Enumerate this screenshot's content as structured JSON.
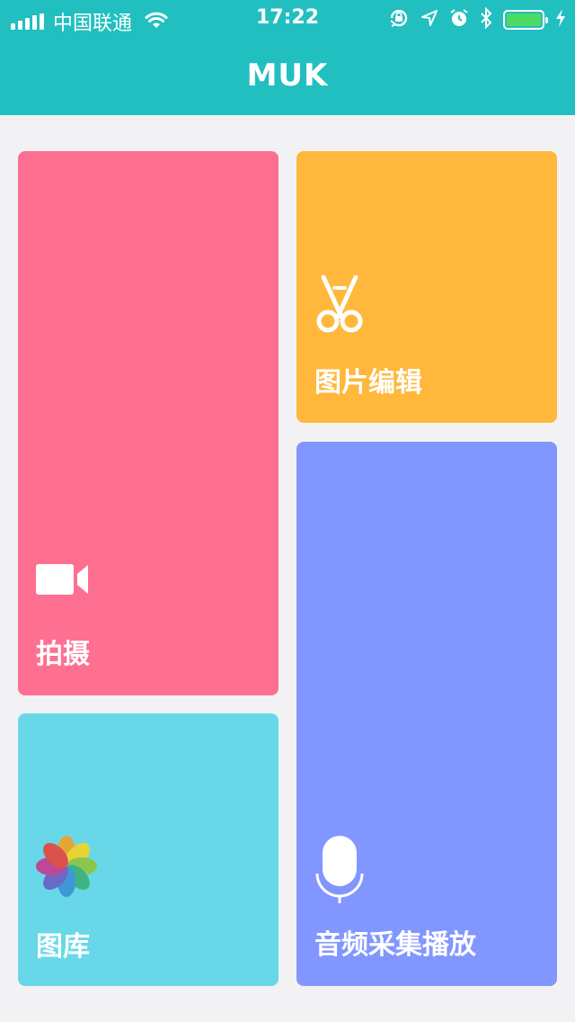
{
  "status_bar": {
    "carrier": "中国联通",
    "time": "17:22",
    "battery_level": 1.0
  },
  "nav": {
    "title": "MUK"
  },
  "tiles": [
    {
      "label": "拍摄",
      "icon": "video-camera-icon",
      "color": "#ff6f91"
    },
    {
      "label": "图片编辑",
      "icon": "scissors-icon",
      "color": "#ffb83c"
    },
    {
      "label": "图库",
      "icon": "photos-icon",
      "color": "#68d8e8"
    },
    {
      "label": "音频采集播放",
      "icon": "microphone-icon",
      "color": "#8296ff"
    }
  ],
  "colors": {
    "header": "#22bfc0",
    "background": "#f2f2f4"
  }
}
